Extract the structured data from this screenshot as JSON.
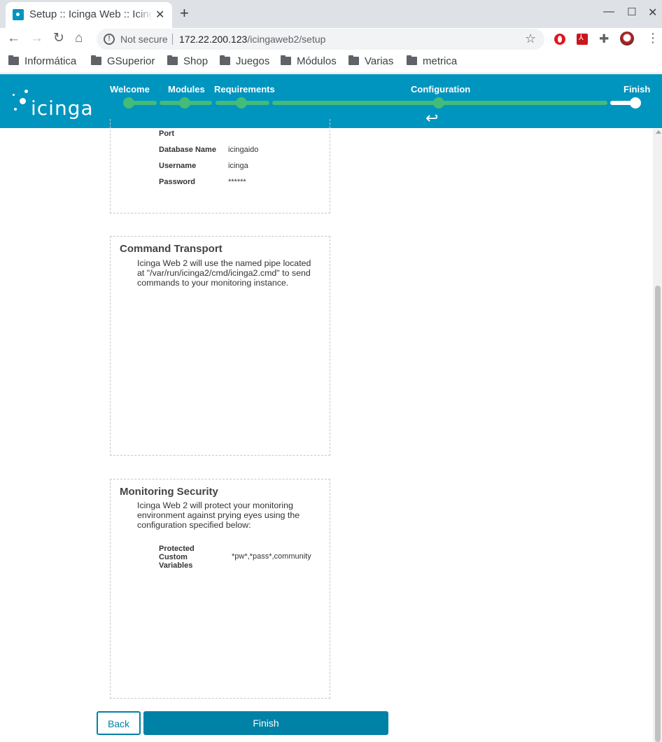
{
  "browser": {
    "tab_title": "Setup :: Icinga Web :: Icinga Web",
    "security_label": "Not secure",
    "url_host": "172.22.200.123",
    "url_path": "/icingaweb2/setup",
    "bookmarks": [
      "Informática",
      "GSuperior",
      "Shop",
      "Juegos",
      "Módulos",
      "Varias",
      "metrica"
    ]
  },
  "header": {
    "logo_text": "icinga",
    "steps": [
      "Welcome",
      "Modules",
      "Requirements",
      "Configuration",
      "Finish"
    ],
    "progress_color": "#44bb77",
    "header_color": "#0095bf"
  },
  "database": {
    "rows": [
      {
        "key": "Port",
        "value": ""
      },
      {
        "key": "Database Name",
        "value": "icingaido"
      },
      {
        "key": "Username",
        "value": "icinga"
      },
      {
        "key": "Password",
        "value": "******"
      }
    ]
  },
  "command_transport": {
    "title": "Command Transport",
    "text": "Icinga Web 2 will use the named pipe located at \"/var/run/icinga2/cmd/icinga2.cmd\" to send commands to your monitoring instance."
  },
  "monitoring_security": {
    "title": "Monitoring Security",
    "text": "Icinga Web 2 will protect your monitoring environment against prying eyes using the configuration specified below:",
    "key": "Protected Custom Variables",
    "value": "*pw*,*pass*,community"
  },
  "buttons": {
    "back": "Back",
    "finish": "Finish"
  }
}
